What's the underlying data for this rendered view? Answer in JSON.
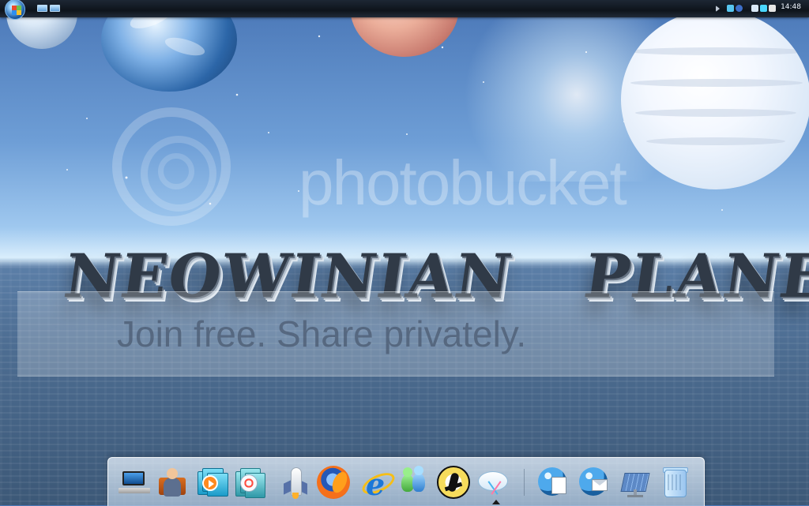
{
  "desktop": {
    "watermark_brand": "photobucket",
    "hero_title_word1": "NEOWINIAN",
    "hero_title_word2": "PLANET",
    "tagline": "Join free. Share privately."
  },
  "taskbar": {
    "clock": "14:48",
    "start_icon": "windows-orb-icon",
    "quick_launch": [
      {
        "icon": "show-desktop-icon"
      },
      {
        "icon": "switch-windows-icon"
      }
    ],
    "tray": [
      {
        "icon": "chevron-left-icon"
      },
      {
        "icon": "network-icon"
      },
      {
        "icon": "bluetooth-icon"
      },
      {
        "icon": "monitor-icon"
      },
      {
        "icon": "speaker-icon"
      }
    ]
  },
  "dock": {
    "items": [
      {
        "icon": "laptop-icon"
      },
      {
        "icon": "user-bag-icon"
      },
      {
        "icon": "media-player-icon"
      },
      {
        "icon": "dvd-icon"
      },
      {
        "icon": "shuttle-icon"
      },
      {
        "icon": "firefox-icon"
      },
      {
        "icon": "internet-explorer-icon"
      },
      {
        "icon": "messenger-icon"
      },
      {
        "icon": "counter-strike-icon"
      },
      {
        "icon": "snipping-tool-icon"
      },
      {
        "icon": "globe-document-icon"
      },
      {
        "icon": "globe-mail-icon"
      },
      {
        "icon": "solar-panel-icon"
      },
      {
        "icon": "recycle-bin-icon"
      }
    ]
  },
  "colors": {
    "taskbar": "#0e141b",
    "dock": "#d6e6f4",
    "accent": "#4a77b7"
  }
}
